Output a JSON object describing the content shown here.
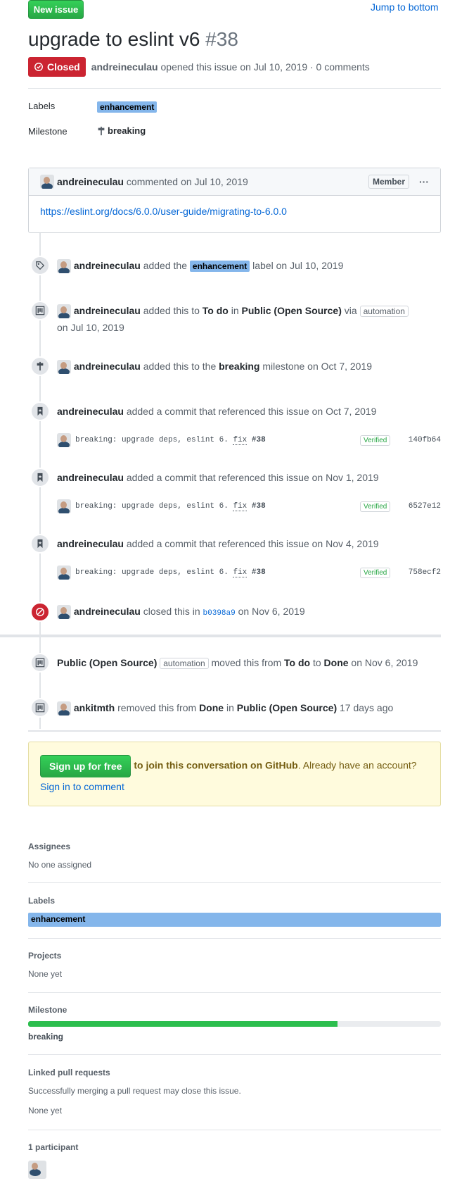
{
  "header": {
    "new_issue_label": "New issue",
    "jump_label": "Jump to bottom",
    "title": "upgrade to eslint v6",
    "number": "#38",
    "state": "Closed",
    "author": "andreineculau",
    "meta_rest": "opened this issue on Jul 10, 2019 · 0 comments"
  },
  "top_meta": {
    "labels_head": "Labels",
    "label": "enhancement",
    "milestone_head": "Milestone",
    "milestone": "breaking"
  },
  "comment": {
    "author": "andreineculau",
    "action": "commented",
    "date": "on Jul 10, 2019",
    "badge": "Member",
    "more": "···",
    "link": "https://eslint.org/docs/6.0.0/user-guide/migrating-to-6.0.0"
  },
  "events": {
    "e1": {
      "user": "andreineculau",
      "pre": "added the",
      "label": "enhancement",
      "post": "label on Jul 10, 2019"
    },
    "e2": {
      "user": "andreineculau",
      "pre": "added this to",
      "col": "To do",
      "in": "in",
      "project": "Public (Open Source)",
      "via": "via",
      "badge": "automation",
      "date": "on Jul 10, 2019"
    },
    "e3": {
      "user": "andreineculau",
      "pre": "added this to the",
      "milestone": "breaking",
      "post": "milestone on Oct 7, 2019"
    },
    "c1": {
      "user": "andreineculau",
      "text": "added a commit that referenced this issue on Oct 7, 2019",
      "msg": "breaking: upgrade deps, eslint 6.",
      "fix": "fix",
      "ref": "#38",
      "verified": "Verified",
      "sha": "140fb64"
    },
    "c2": {
      "user": "andreineculau",
      "text": "added a commit that referenced this issue on Nov 1, 2019",
      "msg": "breaking: upgrade deps, eslint 6.",
      "fix": "fix",
      "ref": "#38",
      "verified": "Verified",
      "sha": "6527e12"
    },
    "c3": {
      "user": "andreineculau",
      "text": "added a commit that referenced this issue on Nov 4, 2019",
      "msg": "breaking: upgrade deps, eslint 6.",
      "fix": "fix",
      "ref": "#38",
      "verified": "Verified",
      "sha": "758ecf2"
    },
    "closed": {
      "user": "andreineculau",
      "pre": "closed this in",
      "sha": "b0398a9",
      "post": "on Nov 6, 2019"
    },
    "moved": {
      "project": "Public (Open Source)",
      "badge": "automation",
      "pre": "moved this from",
      "from": "To do",
      "to_word": "to",
      "to": "Done",
      "post": "on Nov 6, 2019"
    },
    "removed": {
      "user": "ankitmth",
      "pre": "removed this from",
      "col": "Done",
      "in": "in",
      "project": "Public (Open Source)",
      "post": "17 days ago"
    }
  },
  "signup": {
    "button": "Sign up for free",
    "bold": "to join this conversation on GitHub",
    "rest": ". Already have an account? ",
    "link": "Sign in to comment"
  },
  "sidebar": {
    "assignees_head": "Assignees",
    "assignees_value": "No one assigned",
    "labels_head": "Labels",
    "label": "enhancement",
    "projects_head": "Projects",
    "projects_value": "None yet",
    "milestone_head": "Milestone",
    "milestone_progress": 0.75,
    "milestone_value": "breaking",
    "linked_head": "Linked pull requests",
    "linked_desc": "Successfully merging a pull request may close this issue.",
    "linked_value": "None yet",
    "participants_head": "1 participant"
  },
  "colors": {
    "closed": "#cb2431",
    "label": "#84b6eb",
    "green": "#28a745",
    "link": "#0366d6"
  }
}
